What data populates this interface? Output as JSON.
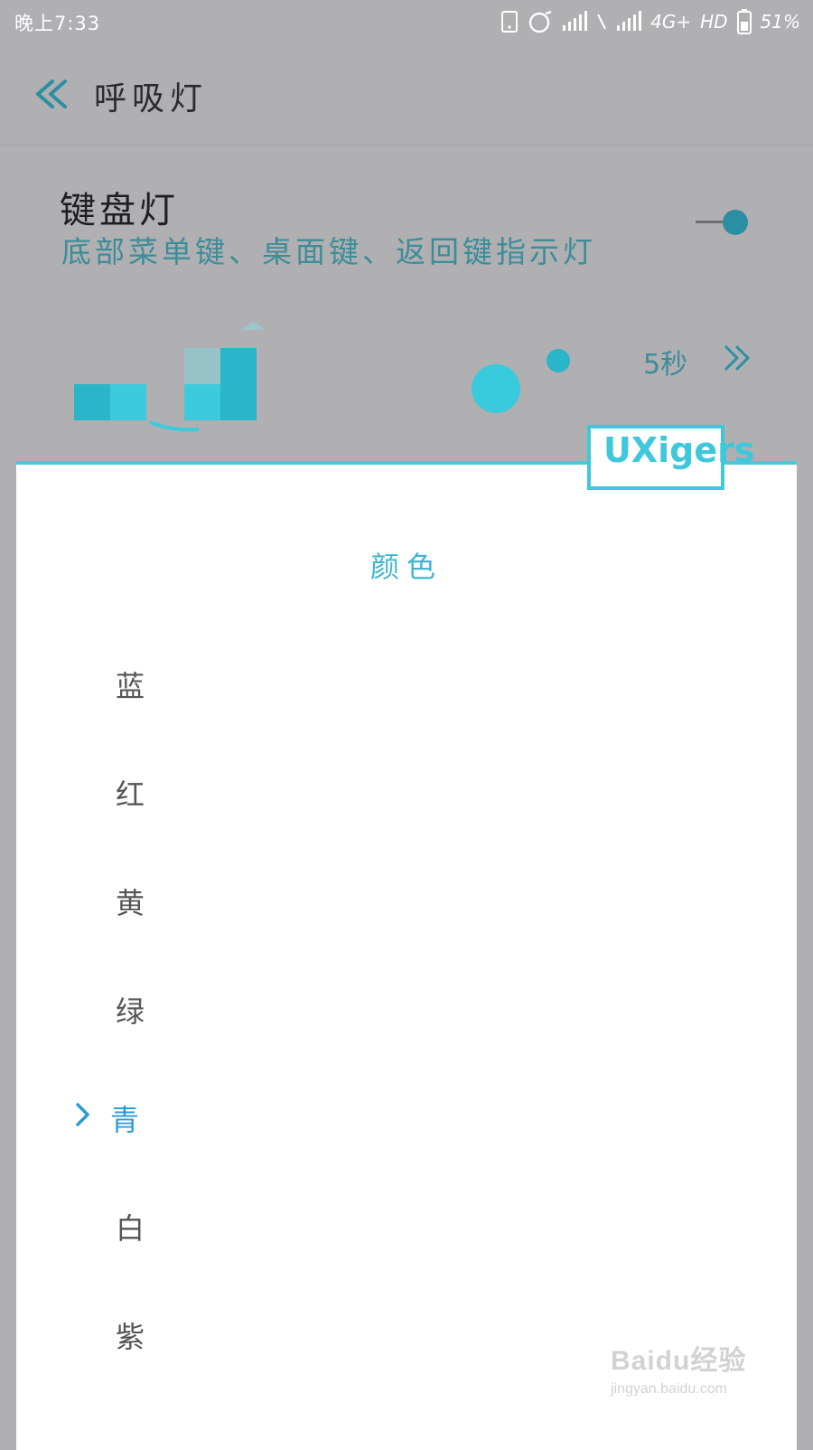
{
  "status_bar": {
    "time": "晚上7:33",
    "network": "4G+",
    "hd": "HD",
    "battery": "51%"
  },
  "header": {
    "title": "呼吸灯"
  },
  "settings": {
    "keyboard_light": {
      "title": "键盘灯",
      "subtitle": "底部菜单键、桌面键、返回键指示灯",
      "enabled": true
    },
    "duration": {
      "value": "5秒"
    }
  },
  "dialog": {
    "title": "颜色",
    "options": [
      {
        "label": "蓝",
        "selected": false
      },
      {
        "label": "红",
        "selected": false
      },
      {
        "label": "黄",
        "selected": false
      },
      {
        "label": "绿",
        "selected": false
      },
      {
        "label": "青",
        "selected": true
      },
      {
        "label": "白",
        "selected": false
      },
      {
        "label": "紫",
        "selected": false
      }
    ]
  },
  "watermarks": {
    "uxigers": "UXigers",
    "baidu_logo": "Baidu经验",
    "baidu_url": "jingyan.baidu.com"
  },
  "colors": {
    "accent": "#3fb6cd",
    "selected_option": "#2b9ad4",
    "overlay": "#b0afb2"
  }
}
